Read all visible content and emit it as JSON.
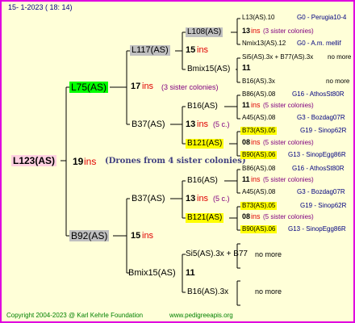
{
  "header": {
    "date_line": "15-   1-2023 (  18:  14)"
  },
  "colors": {
    "border": "#e000e0",
    "background": "#ffffd8",
    "green": "#00ff00",
    "gray": "#c0c0c0",
    "yellow": "#ffff00",
    "pink": "#ffd0e0",
    "line": "#000000"
  },
  "root": {
    "name": "L123(AS)",
    "num": "19",
    "ins": "ins",
    "drones": "(Drones from 4 sister colonies)"
  },
  "l75": {
    "name": "L75(AS)",
    "num": "17",
    "ins": "ins",
    "sis": "(3 sister colonies)"
  },
  "b92": {
    "name": "B92(AS)",
    "num": "15",
    "ins": "ins"
  },
  "l117": {
    "name": "L117(AS)",
    "num": "15",
    "ins": "ins"
  },
  "b37a": {
    "name": "B37(AS)",
    "num": "13",
    "ins": "ins",
    "sis": "(5 c.)"
  },
  "b37b": {
    "name": "B37(AS)",
    "num": "13",
    "ins": "ins",
    "sis": "(5 c.)"
  },
  "bmix15b": {
    "name": "Bmix15(AS)",
    "num": "11"
  },
  "l108": {
    "name": "L108(AS)",
    "num": "13",
    "ins": "ins",
    "sis": "(3 sister colonies)"
  },
  "bmix15a": {
    "name": "Bmix15(AS)",
    "num": "11"
  },
  "b16a": {
    "name": "B16(AS)",
    "num": "11",
    "ins": "ins",
    "sis": "(5 sister colonies)"
  },
  "b121a": {
    "name": "B121(AS)",
    "num": "08",
    "ins": "ins",
    "sis": "(5 sister colonies)"
  },
  "b16b": {
    "name": "B16(AS)",
    "num": "11",
    "ins": "ins",
    "sis": "(5 sister colonies)"
  },
  "b121b": {
    "name": "B121(AS)",
    "num": "08",
    "ins": "ins",
    "sis": "(5 sister colonies)"
  },
  "si5": {
    "name": "Si5(AS).3x + B77",
    "more": "no more"
  },
  "b16c": {
    "name": "B16(AS).3x",
    "more": "no more"
  },
  "g4": {
    "r1": {
      "name": "L13(AS).10",
      "ref": "G0 - Perugia10-4"
    },
    "r2": {
      "name": "Nmix13(AS).12",
      "ref": "G0 - A.m. mellif"
    },
    "r3": {
      "name": "Si5(AS).3x + B77(AS).3x",
      "more": "no more"
    },
    "r4": {
      "name": "B16(AS).3x",
      "more": "no more"
    },
    "r5": {
      "name": "B86(AS).08",
      "ref": "G16 - AthosSt80R"
    },
    "r6": {
      "name": "A45(AS).08",
      "ref": "G3 - Bozdag07R"
    },
    "r7": {
      "name": "B73(AS).05",
      "ref": "G19 - Sinop62R"
    },
    "r8": {
      "name": "B90(AS).06",
      "ref": "G13 - SinopEgg86R"
    },
    "r9": {
      "name": "B86(AS).08",
      "ref": "G16 - AthosSt80R"
    },
    "r10": {
      "name": "A45(AS).08",
      "ref": "G3 - Bozdag07R"
    },
    "r11": {
      "name": "B73(AS).05",
      "ref": "G19 - Sinop62R"
    },
    "r12": {
      "name": "B90(AS).06",
      "ref": "G13 - SinopEgg86R"
    }
  },
  "footer": {
    "copyright": "Copyright 2004-2023 @ Karl Kehrle Foundation",
    "site": "www.pedigreeapis.org"
  }
}
